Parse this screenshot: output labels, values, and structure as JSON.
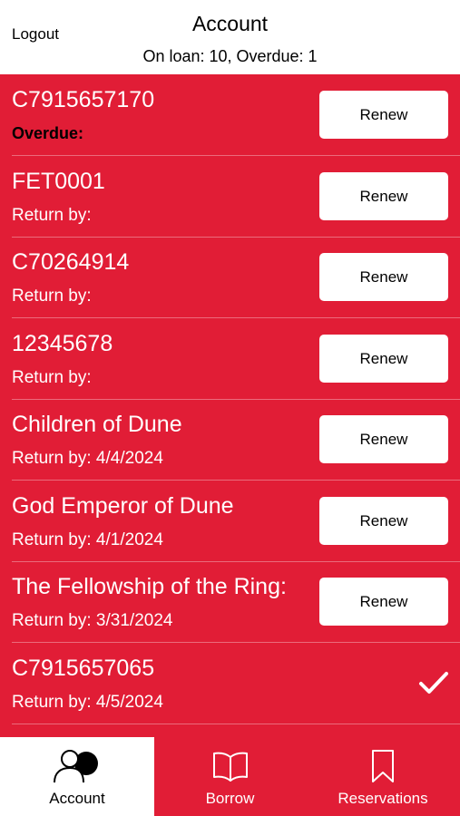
{
  "header": {
    "logout_label": "Logout",
    "title": "Account",
    "subtitle": "On loan: 10, Overdue: 1"
  },
  "loans": [
    {
      "name": "C7915657170",
      "due_text": "Overdue:",
      "overdue": true,
      "action": "Renew"
    },
    {
      "name": "FET0001",
      "due_text": "Return by:",
      "overdue": false,
      "action": "Renew"
    },
    {
      "name": "C70264914",
      "due_text": "Return by:",
      "overdue": false,
      "action": "Renew"
    },
    {
      "name": "12345678",
      "due_text": "Return by:",
      "overdue": false,
      "action": "Renew"
    },
    {
      "name": "Children of Dune",
      "due_text": "Return by: 4/4/2024",
      "overdue": false,
      "action": "Renew"
    },
    {
      "name": "God Emperor of Dune",
      "due_text": "Return by: 4/1/2024",
      "overdue": false,
      "action": "Renew"
    },
    {
      "name": "The Fellowship of the Ring:",
      "due_text": "Return by: 3/31/2024",
      "overdue": false,
      "action": "Renew"
    },
    {
      "name": "C7915657065",
      "due_text": "Return by: 4/5/2024",
      "overdue": false,
      "action": "",
      "renewed_icon": "checkmark-icon"
    }
  ],
  "tabs": [
    {
      "label": "Account",
      "icon": "account-icon",
      "active": true
    },
    {
      "label": "Borrow",
      "icon": "book-icon",
      "active": false
    },
    {
      "label": "Reservations",
      "icon": "bookmark-icon",
      "active": false
    }
  ],
  "colors": {
    "accent": "#e11d36",
    "button_bg": "#ffffff",
    "overdue_text": "#000000"
  }
}
